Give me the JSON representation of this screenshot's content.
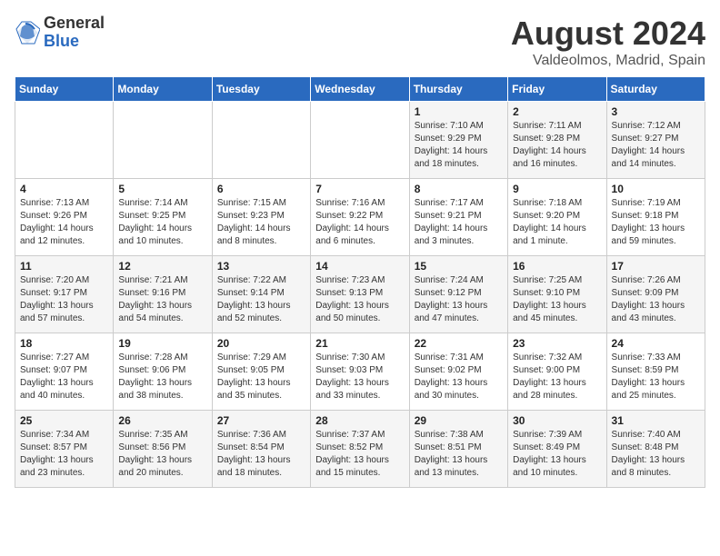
{
  "logo": {
    "general": "General",
    "blue": "Blue"
  },
  "header": {
    "month": "August 2024",
    "location": "Valdeolmos, Madrid, Spain"
  },
  "days_of_week": [
    "Sunday",
    "Monday",
    "Tuesday",
    "Wednesday",
    "Thursday",
    "Friday",
    "Saturday"
  ],
  "weeks": [
    [
      {
        "num": "",
        "info": ""
      },
      {
        "num": "",
        "info": ""
      },
      {
        "num": "",
        "info": ""
      },
      {
        "num": "",
        "info": ""
      },
      {
        "num": "1",
        "info": "Sunrise: 7:10 AM\nSunset: 9:29 PM\nDaylight: 14 hours\nand 18 minutes."
      },
      {
        "num": "2",
        "info": "Sunrise: 7:11 AM\nSunset: 9:28 PM\nDaylight: 14 hours\nand 16 minutes."
      },
      {
        "num": "3",
        "info": "Sunrise: 7:12 AM\nSunset: 9:27 PM\nDaylight: 14 hours\nand 14 minutes."
      }
    ],
    [
      {
        "num": "4",
        "info": "Sunrise: 7:13 AM\nSunset: 9:26 PM\nDaylight: 14 hours\nand 12 minutes."
      },
      {
        "num": "5",
        "info": "Sunrise: 7:14 AM\nSunset: 9:25 PM\nDaylight: 14 hours\nand 10 minutes."
      },
      {
        "num": "6",
        "info": "Sunrise: 7:15 AM\nSunset: 9:23 PM\nDaylight: 14 hours\nand 8 minutes."
      },
      {
        "num": "7",
        "info": "Sunrise: 7:16 AM\nSunset: 9:22 PM\nDaylight: 14 hours\nand 6 minutes."
      },
      {
        "num": "8",
        "info": "Sunrise: 7:17 AM\nSunset: 9:21 PM\nDaylight: 14 hours\nand 3 minutes."
      },
      {
        "num": "9",
        "info": "Sunrise: 7:18 AM\nSunset: 9:20 PM\nDaylight: 14 hours\nand 1 minute."
      },
      {
        "num": "10",
        "info": "Sunrise: 7:19 AM\nSunset: 9:18 PM\nDaylight: 13 hours\nand 59 minutes."
      }
    ],
    [
      {
        "num": "11",
        "info": "Sunrise: 7:20 AM\nSunset: 9:17 PM\nDaylight: 13 hours\nand 57 minutes."
      },
      {
        "num": "12",
        "info": "Sunrise: 7:21 AM\nSunset: 9:16 PM\nDaylight: 13 hours\nand 54 minutes."
      },
      {
        "num": "13",
        "info": "Sunrise: 7:22 AM\nSunset: 9:14 PM\nDaylight: 13 hours\nand 52 minutes."
      },
      {
        "num": "14",
        "info": "Sunrise: 7:23 AM\nSunset: 9:13 PM\nDaylight: 13 hours\nand 50 minutes."
      },
      {
        "num": "15",
        "info": "Sunrise: 7:24 AM\nSunset: 9:12 PM\nDaylight: 13 hours\nand 47 minutes."
      },
      {
        "num": "16",
        "info": "Sunrise: 7:25 AM\nSunset: 9:10 PM\nDaylight: 13 hours\nand 45 minutes."
      },
      {
        "num": "17",
        "info": "Sunrise: 7:26 AM\nSunset: 9:09 PM\nDaylight: 13 hours\nand 43 minutes."
      }
    ],
    [
      {
        "num": "18",
        "info": "Sunrise: 7:27 AM\nSunset: 9:07 PM\nDaylight: 13 hours\nand 40 minutes."
      },
      {
        "num": "19",
        "info": "Sunrise: 7:28 AM\nSunset: 9:06 PM\nDaylight: 13 hours\nand 38 minutes."
      },
      {
        "num": "20",
        "info": "Sunrise: 7:29 AM\nSunset: 9:05 PM\nDaylight: 13 hours\nand 35 minutes."
      },
      {
        "num": "21",
        "info": "Sunrise: 7:30 AM\nSunset: 9:03 PM\nDaylight: 13 hours\nand 33 minutes."
      },
      {
        "num": "22",
        "info": "Sunrise: 7:31 AM\nSunset: 9:02 PM\nDaylight: 13 hours\nand 30 minutes."
      },
      {
        "num": "23",
        "info": "Sunrise: 7:32 AM\nSunset: 9:00 PM\nDaylight: 13 hours\nand 28 minutes."
      },
      {
        "num": "24",
        "info": "Sunrise: 7:33 AM\nSunset: 8:59 PM\nDaylight: 13 hours\nand 25 minutes."
      }
    ],
    [
      {
        "num": "25",
        "info": "Sunrise: 7:34 AM\nSunset: 8:57 PM\nDaylight: 13 hours\nand 23 minutes."
      },
      {
        "num": "26",
        "info": "Sunrise: 7:35 AM\nSunset: 8:56 PM\nDaylight: 13 hours\nand 20 minutes."
      },
      {
        "num": "27",
        "info": "Sunrise: 7:36 AM\nSunset: 8:54 PM\nDaylight: 13 hours\nand 18 minutes."
      },
      {
        "num": "28",
        "info": "Sunrise: 7:37 AM\nSunset: 8:52 PM\nDaylight: 13 hours\nand 15 minutes."
      },
      {
        "num": "29",
        "info": "Sunrise: 7:38 AM\nSunset: 8:51 PM\nDaylight: 13 hours\nand 13 minutes."
      },
      {
        "num": "30",
        "info": "Sunrise: 7:39 AM\nSunset: 8:49 PM\nDaylight: 13 hours\nand 10 minutes."
      },
      {
        "num": "31",
        "info": "Sunrise: 7:40 AM\nSunset: 8:48 PM\nDaylight: 13 hours\nand 8 minutes."
      }
    ]
  ]
}
